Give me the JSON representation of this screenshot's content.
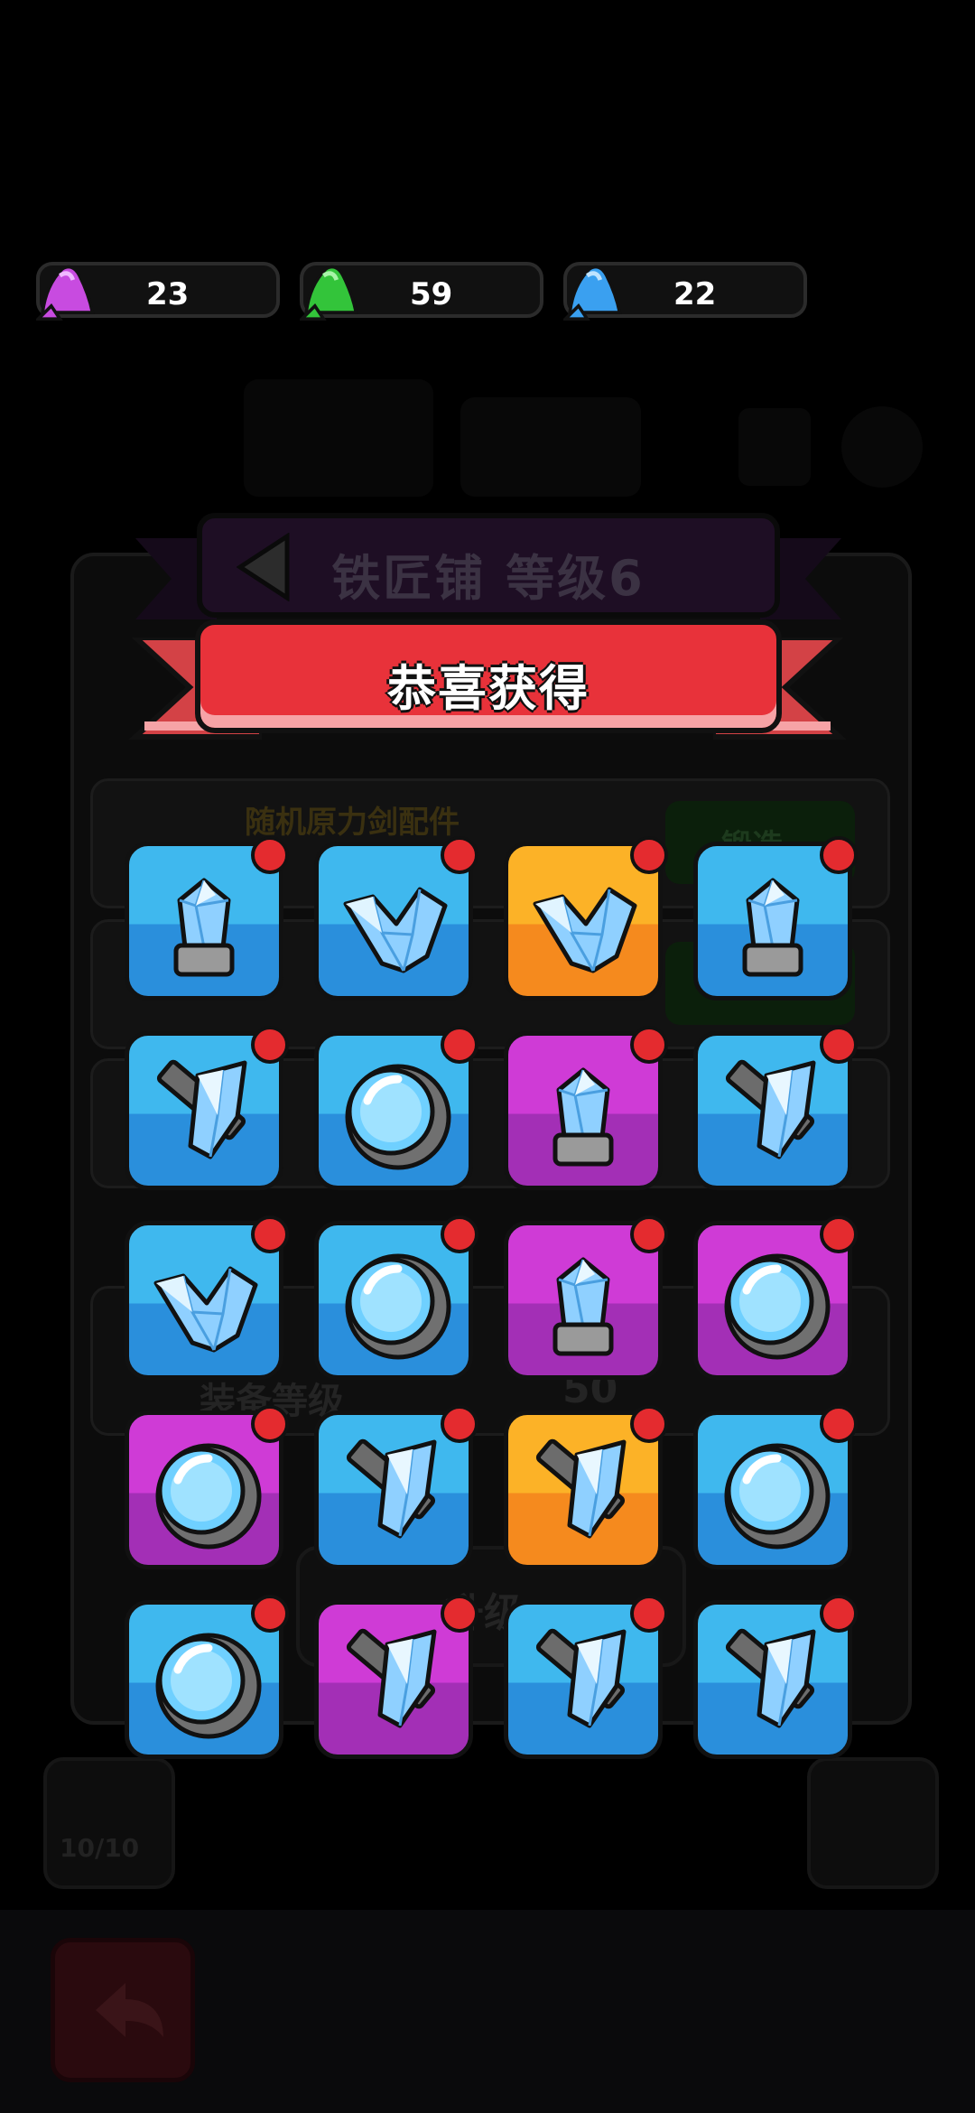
{
  "resources": [
    {
      "name": "purple-stone",
      "color": "#c84be0",
      "value": "23"
    },
    {
      "name": "green-stone",
      "color": "#33c43a",
      "value": "59"
    },
    {
      "name": "blue-stone",
      "color": "#3aa0f0",
      "value": "22"
    }
  ],
  "shop": {
    "title": "铁匠铺  等级6"
  },
  "popup": {
    "title": "恭喜获得"
  },
  "background": {
    "row1_title": "随机原力剑配件",
    "forge_label": "锻造",
    "equip_level_label": "装备等级",
    "equip_level_value": "50",
    "upgrade_label": "升级",
    "counter": "10/10"
  },
  "rewards": [
    {
      "rarity": "blue",
      "item": "crystal-icon"
    },
    {
      "rarity": "blue",
      "item": "shard-icon"
    },
    {
      "rarity": "orange",
      "item": "shard-icon"
    },
    {
      "rarity": "blue",
      "item": "crystal-icon"
    },
    {
      "rarity": "blue",
      "item": "blade-icon"
    },
    {
      "rarity": "blue",
      "item": "lens-icon"
    },
    {
      "rarity": "purple",
      "item": "crystal-icon"
    },
    {
      "rarity": "blue",
      "item": "blade-icon"
    },
    {
      "rarity": "blue",
      "item": "shard-icon"
    },
    {
      "rarity": "blue",
      "item": "lens-icon"
    },
    {
      "rarity": "purple",
      "item": "crystal-icon"
    },
    {
      "rarity": "purple",
      "item": "lens-icon"
    },
    {
      "rarity": "purple",
      "item": "lens-icon"
    },
    {
      "rarity": "blue",
      "item": "blade-icon"
    },
    {
      "rarity": "orange",
      "item": "blade-icon"
    },
    {
      "rarity": "blue",
      "item": "lens-icon"
    },
    {
      "rarity": "blue",
      "item": "lens-icon"
    },
    {
      "rarity": "purple",
      "item": "blade-icon"
    },
    {
      "rarity": "blue",
      "item": "blade-icon"
    },
    {
      "rarity": "blue",
      "item": "blade-icon"
    }
  ]
}
